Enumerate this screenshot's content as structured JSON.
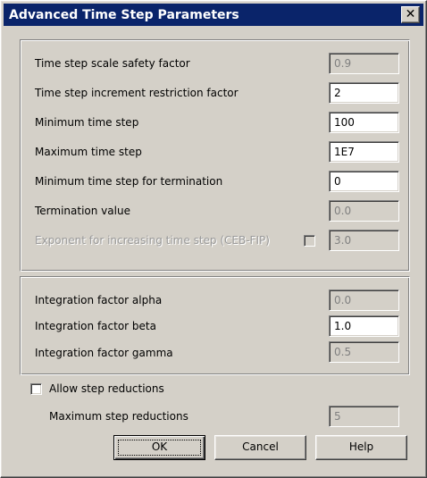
{
  "dialog": {
    "title": "Advanced Time Step Parameters",
    "close_glyph": "✕"
  },
  "group1": {
    "rows": [
      {
        "label": "Time step scale safety factor",
        "value": "0.9",
        "enabled": false
      },
      {
        "label": "Time step increment restriction factor",
        "value": "2",
        "enabled": true
      },
      {
        "label": "Minimum time step",
        "value": "100",
        "enabled": true
      },
      {
        "label": "Maximum time step",
        "value": "1E7",
        "enabled": true
      },
      {
        "label": "Minimum time step for termination",
        "value": "0",
        "enabled": true
      },
      {
        "label": "Termination value",
        "value": "0.0",
        "enabled": false
      },
      {
        "label": "Exponent for increasing time step (CEB-FIP)",
        "value": "3.0",
        "enabled": false,
        "checkbox_checked": false
      }
    ]
  },
  "group2": {
    "rows": [
      {
        "label": "Integration factor alpha",
        "value": "0.0",
        "enabled": false
      },
      {
        "label": "Integration factor beta",
        "value": "1.0",
        "enabled": true
      },
      {
        "label": "Integration factor gamma",
        "value": "0.5",
        "enabled": false
      }
    ]
  },
  "step_reductions": {
    "allow_label": "Allow step reductions",
    "allow_checked": false,
    "max_label": "Maximum step reductions",
    "max_value": "5"
  },
  "buttons": {
    "ok": "OK",
    "cancel": "Cancel",
    "help": "Help"
  },
  "colors": {
    "title_bar": "#0a246a",
    "dialog_face": "#d4d0c8",
    "disabled_text": "#808080"
  }
}
